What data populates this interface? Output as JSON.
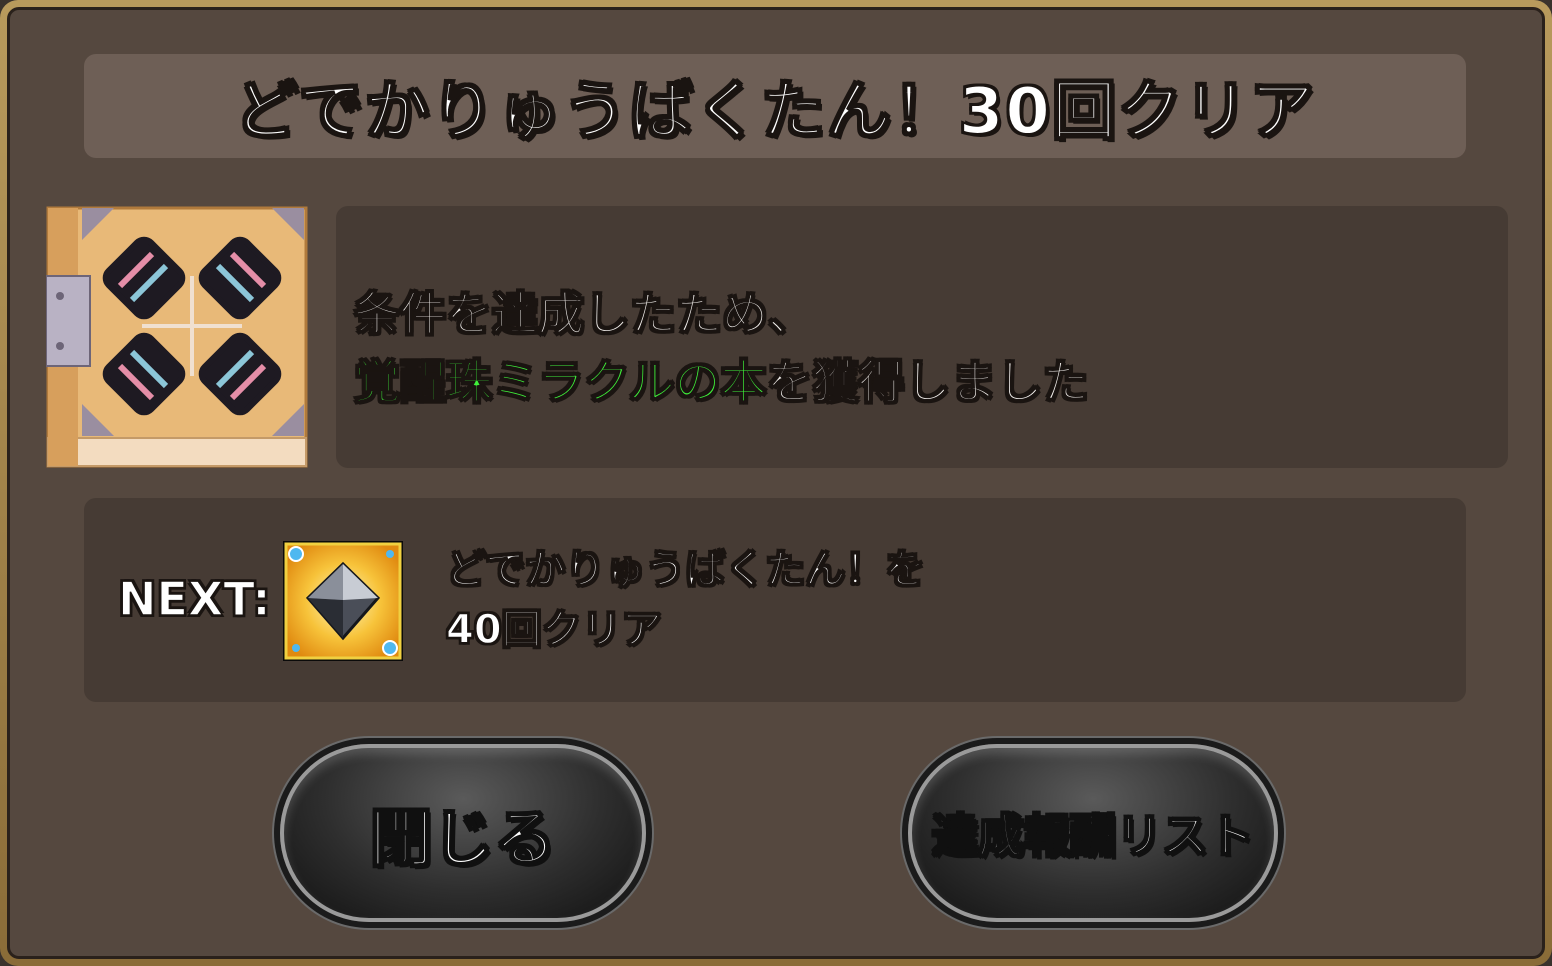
{
  "dialog": {
    "title": "どでかりゅうばくたん！30回クリア"
  },
  "message": {
    "line1": "条件を達成したため、",
    "line2_highlight": "覚醒珠ミラクルの本",
    "line2_rest": "を獲得しました"
  },
  "reward": {
    "icon": "miracle-book-icon"
  },
  "next": {
    "label": "NEXT:",
    "icon": "gem-icon",
    "line1": "どでかりゅうばくたん！を",
    "line2": "40回クリア"
  },
  "buttons": {
    "close_label": "閉じる",
    "reward_list_label": "達成報酬リスト"
  },
  "colors": {
    "highlight": "#3ff23a",
    "frame": "#b89a5c",
    "panel": "#55483f"
  }
}
